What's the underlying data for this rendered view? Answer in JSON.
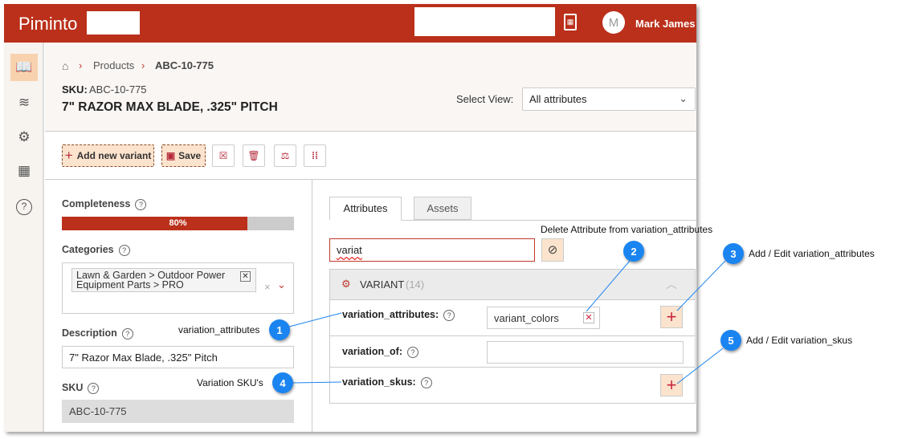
{
  "header": {
    "logo": "Piminto",
    "user_initial": "M",
    "user_name": "Mark James"
  },
  "breadcrumb": {
    "items": [
      "Products",
      "ABC-10-775"
    ]
  },
  "product": {
    "sku_label": "SKU:",
    "sku": "ABC-10-775",
    "title": "7\" RAZOR MAX BLADE, .325\" PITCH"
  },
  "view": {
    "label": "Select View:",
    "value": "All attributes"
  },
  "toolbar": {
    "add_variant": "Add new variant",
    "save": "Save"
  },
  "left": {
    "completeness_label": "Completeness",
    "completeness_value": "80%",
    "completeness_pct": 80,
    "categories_label": "Categories",
    "category_tag": "Lawn & Garden > Outdoor Power Equipment Parts > PRO",
    "description_label": "Description",
    "description_value": "7\" Razor Max Blade, .325\" Pitch",
    "sku_label": "SKU",
    "sku_value": "ABC-10-775"
  },
  "tabs": [
    "Attributes",
    "Assets"
  ],
  "filter": {
    "value": "variat"
  },
  "section": {
    "title": "VARIANT",
    "count": "(14)"
  },
  "rows": [
    {
      "label": "variation_attributes:",
      "value": "variant_colors"
    },
    {
      "label": "variation_of:",
      "value": ""
    },
    {
      "label": "variation_skus:"
    }
  ],
  "callouts": [
    {
      "n": "1",
      "text": "variation_attributes"
    },
    {
      "n": "2",
      "text": "Delete Attribute from variation_attributes"
    },
    {
      "n": "3",
      "text": "Add / Edit variation_attributes"
    },
    {
      "n": "4",
      "text": "Variation SKU's"
    },
    {
      "n": "5",
      "text": "Add / Edit variation_skus"
    }
  ],
  "colors": {
    "brand": "#bb301b",
    "accent_bg": "#fbe3cd",
    "callout": "#1a84f0"
  }
}
